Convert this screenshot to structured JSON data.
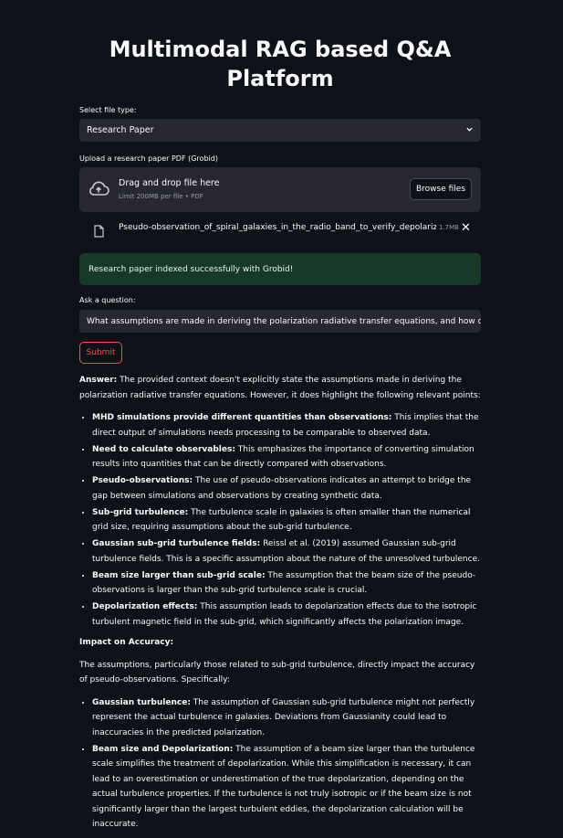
{
  "title": "Multimodal RAG based Q&A Platform",
  "file_type": {
    "label": "Select file type:",
    "selected": "Research Paper"
  },
  "upload": {
    "label": "Upload a research paper PDF (Grobid)",
    "drop_text": "Drag and drop file here",
    "limit_text": "Limit 200MB per file • PDF",
    "browse_label": "Browse files",
    "file_name": "Pseudo-observation_of_spiral_galaxies_in_the_radio_band_to_verify_depolariz...",
    "file_size": "1.7MB"
  },
  "status": "Research paper indexed successfully with Grobid!",
  "question": {
    "label": "Ask a question:",
    "value": "What assumptions are made in deriving the polarization radiative transfer equations, and how do they"
  },
  "submit_label": "Submit",
  "answer": {
    "label": "Answer:",
    "intro": "The provided context doesn't explicitly state the assumptions made in deriving the polarization radiative transfer equations. However, it does highlight the following relevant points:",
    "points": [
      {
        "title": "MHD simulations provide different quantities than observations:",
        "text": "This implies that the direct output of simulations needs processing to be comparable to observed data."
      },
      {
        "title": "Need to calculate observables:",
        "text": "This emphasizes the importance of converting simulation results into quantities that can be directly compared with observations."
      },
      {
        "title": "Pseudo-observations:",
        "text": "The use of pseudo-observations indicates an attempt to bridge the gap between simulations and observations by creating synthetic data."
      },
      {
        "title": "Sub-grid turbulence:",
        "text": "The turbulence scale in galaxies is often smaller than the numerical grid size, requiring assumptions about the sub-grid turbulence."
      },
      {
        "title": "Gaussian sub-grid turbulence fields:",
        "text": "Reissl et al. (2019) assumed Gaussian sub-grid turbulence fields. This is a specific assumption about the nature of the unresolved turbulence."
      },
      {
        "title": "Beam size larger than sub-grid scale:",
        "text": "The assumption that the beam size of the pseudo-observations is larger than the sub-grid turbulence scale is crucial."
      },
      {
        "title": "Depolarization effects:",
        "text": "This assumption leads to depolarization effects due to the isotropic turbulent magnetic field in the sub-grid, which significantly affects the polarization image."
      }
    ],
    "impact_heading": "Impact on Accuracy:",
    "impact_intro": "The assumptions, particularly those related to sub-grid turbulence, directly impact the accuracy of pseudo-observations. Specifically:",
    "impact_points": [
      {
        "title": "Gaussian turbulence:",
        "text": "The assumption of Gaussian sub-grid turbulence might not perfectly represent the actual turbulence in galaxies. Deviations from Gaussianity could lead to inaccuracies in the predicted polarization."
      },
      {
        "title": "Beam size and Depolarization:",
        "text": "The assumption of a beam size larger than the turbulence scale simplifies the treatment of depolarization. While this simplification is necessary, it can lead to an overestimation or underestimation of the true depolarization, depending on the actual turbulence properties. If the turbulence is not truly isotropic or if the beam size is not significantly larger than the largest turbulent eddies, the depolarization calculation will be inaccurate."
      }
    ]
  },
  "colors": {
    "background": "#0e1117",
    "widget": "#262730",
    "accent": "#ff4b4b",
    "success_bg": "#173928"
  }
}
